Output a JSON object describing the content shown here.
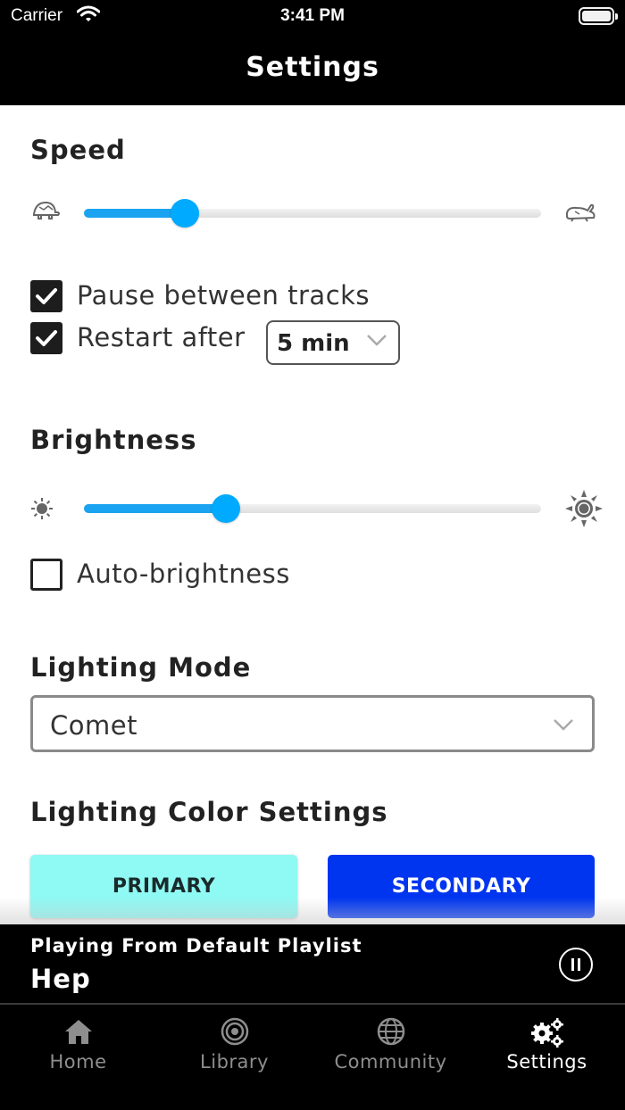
{
  "status_bar": {
    "carrier": "Carrier",
    "time": "3:41 PM"
  },
  "header": {
    "title": "Settings"
  },
  "speed": {
    "title": "Speed",
    "slow_icon": "turtle-icon",
    "fast_icon": "rabbit-icon",
    "value": 0.22
  },
  "pause_between_tracks": {
    "label": "Pause between tracks",
    "checked": true
  },
  "restart_after": {
    "label": "Restart after",
    "checked": true,
    "value": "5 min"
  },
  "brightness": {
    "title": "Brightness",
    "low_icon": "sun-small-icon",
    "high_icon": "sun-large-icon",
    "value": 0.31
  },
  "auto_brightness": {
    "label": "Auto-brightness",
    "checked": false
  },
  "lighting_mode": {
    "title": "Lighting Mode",
    "value": "Comet"
  },
  "lighting_color": {
    "title": "Lighting Color Settings",
    "primary_label": "PRIMARY",
    "secondary_label": "SECONDARY",
    "primary_color": "#8ff9f4",
    "secondary_color": "#0035f0"
  },
  "now_playing": {
    "subtitle": "Playing From Default Playlist",
    "title": "Hep"
  },
  "tabs": [
    {
      "label": "Home",
      "icon": "home-icon",
      "active": false
    },
    {
      "label": "Library",
      "icon": "target-icon",
      "active": false
    },
    {
      "label": "Community",
      "icon": "globe-icon",
      "active": false
    },
    {
      "label": "Settings",
      "icon": "gears-icon",
      "active": true
    }
  ],
  "colors": {
    "accent": "#00aaff",
    "header_bg": "#000000"
  }
}
